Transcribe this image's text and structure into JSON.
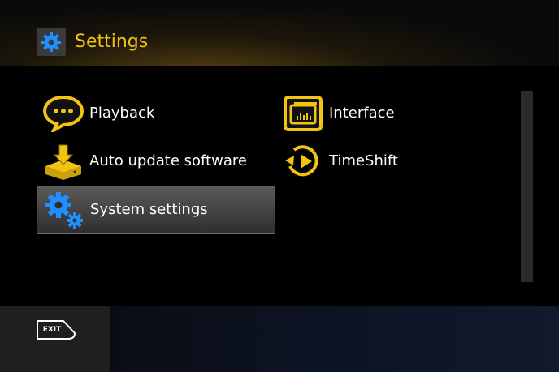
{
  "header": {
    "title": "Settings",
    "icon": "gear-icon"
  },
  "menu": {
    "items": [
      {
        "label": "Playback",
        "icon": "speech-bubble-icon"
      },
      {
        "label": "Interface",
        "icon": "display-icon"
      },
      {
        "label": "Auto update software",
        "icon": "download-box-icon"
      },
      {
        "label": "TimeShift",
        "icon": "timeshift-icon"
      },
      {
        "label": "System settings",
        "icon": "gears-icon",
        "selected": true
      }
    ]
  },
  "footer": {
    "exit_label": "EXIT"
  },
  "colors": {
    "accent": "#f1c40f",
    "gear": "#1e90ff",
    "selection": "#4a4a4a"
  }
}
